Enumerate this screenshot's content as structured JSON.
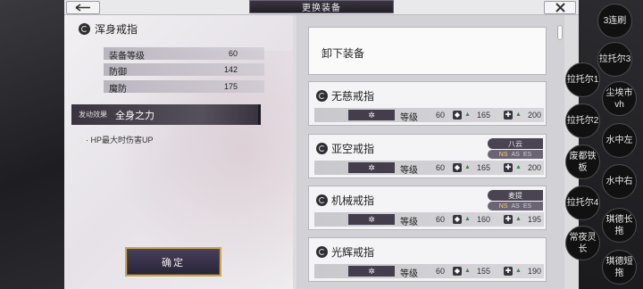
{
  "window": {
    "title": "更换装备"
  },
  "detail": {
    "item_name": "浑身戒指",
    "stats": [
      {
        "label": "装备等级",
        "value": "60"
      },
      {
        "label": "防御",
        "value": "142"
      },
      {
        "label": "魔防",
        "value": "175"
      }
    ],
    "effect_tag": "发动效果",
    "effect_name": "全身之力",
    "effect_desc": "· HP最大时伤害UP",
    "confirm_label": "确定"
  },
  "list": {
    "unequip_label": "卸下装备",
    "level_label": "等级",
    "items": [
      {
        "name": "无慈戒指",
        "level": "60",
        "def": "165",
        "mdef": "200",
        "owner": "",
        "tags": ""
      },
      {
        "name": "亚空戒指",
        "level": "60",
        "def": "165",
        "mdef": "200",
        "owner": "八云",
        "tags": "NS AS ES"
      },
      {
        "name": "机械戒指",
        "level": "60",
        "def": "160",
        "mdef": "195",
        "owner": "麦提",
        "tags": "NS AS ES"
      },
      {
        "name": "光辉戒指",
        "level": "60",
        "def": "155",
        "mdef": "190",
        "owner": "",
        "tags": ""
      }
    ]
  },
  "side_buttons": {
    "b1": "3连刷",
    "b2": "拉托尔3",
    "b3": "拉托尔1",
    "b4": "尘埃市vh",
    "b5": "拉托尔2",
    "b6": "水中左",
    "b7": "废都铁板",
    "b8": "水中右",
    "b9": "拉托尔4",
    "b10": "琪德长拖",
    "b11": "常夜灵长",
    "b12": "琪德短拖"
  }
}
